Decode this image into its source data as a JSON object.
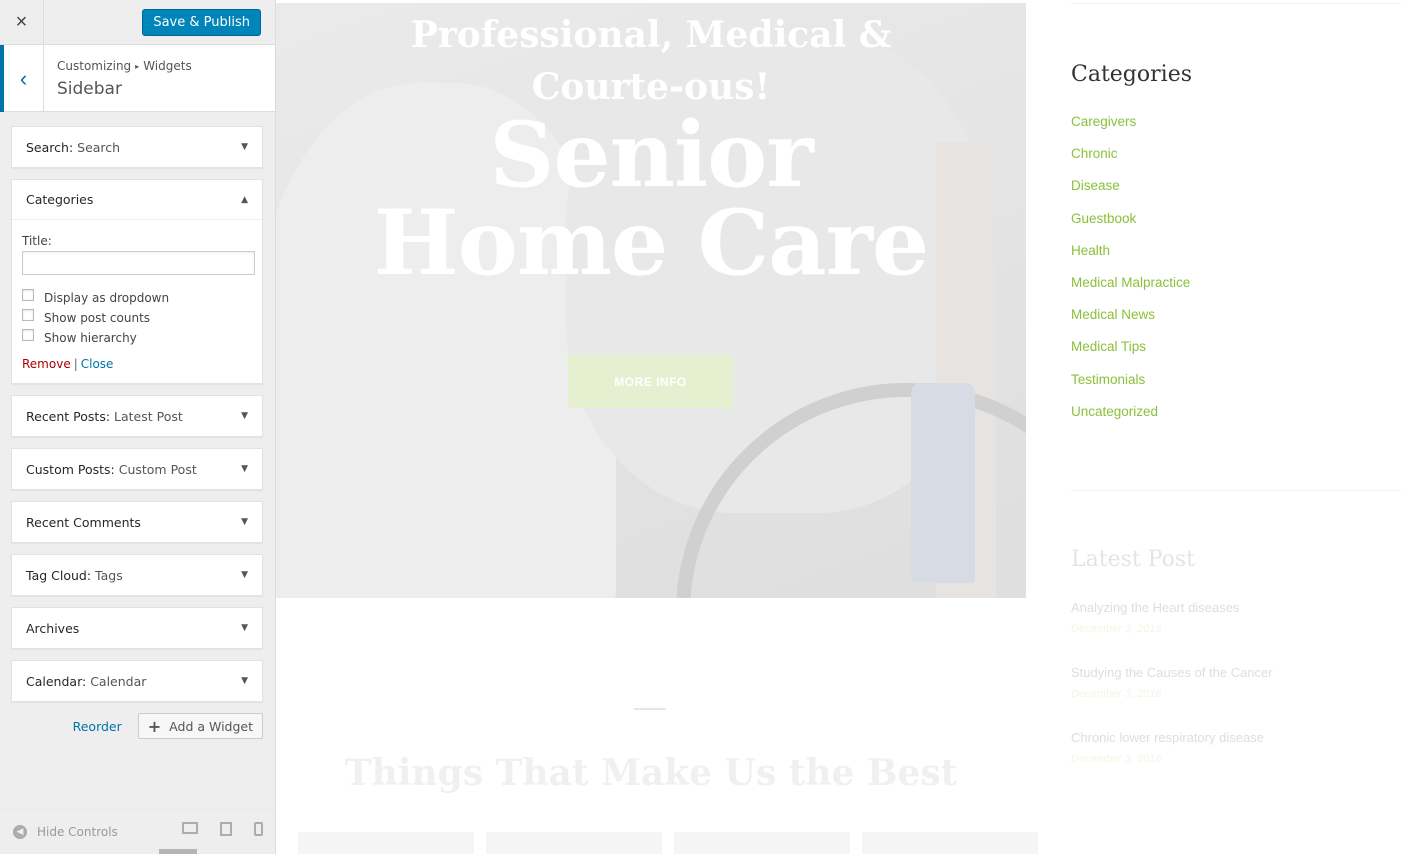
{
  "customizer": {
    "close_label": "×",
    "publish_label": "Save & Publish",
    "back_label": "‹",
    "breadcrumb": {
      "root": "Customizing",
      "separator": "▸",
      "parent": "Widgets"
    },
    "section_title": "Sidebar",
    "widgets": [
      {
        "name": "Search",
        "title": "Search",
        "open": false
      },
      {
        "name": "Categories",
        "title": "",
        "open": true
      },
      {
        "name": "Recent Posts",
        "title": "Latest Post",
        "open": false
      },
      {
        "name": "Custom Posts",
        "title": "Custom Post",
        "open": false
      },
      {
        "name": "Recent Comments",
        "title": "",
        "open": false
      },
      {
        "name": "Tag Cloud",
        "title": "Tags",
        "open": false
      },
      {
        "name": "Archives",
        "title": "",
        "open": false
      },
      {
        "name": "Calendar",
        "title": "Calendar",
        "open": false
      }
    ],
    "categories_form": {
      "title_label": "Title:",
      "title_value": "",
      "checkboxes": [
        {
          "label": "Display as dropdown",
          "checked": false
        },
        {
          "label": "Show post counts",
          "checked": false
        },
        {
          "label": "Show hierarchy",
          "checked": false
        }
      ],
      "remove_label": "Remove",
      "separator": "|",
      "close_label": "Close"
    },
    "reorder_label": "Reorder",
    "add_widget_label": "Add a Widget",
    "hide_controls_label": "Hide Controls"
  },
  "preview": {
    "hero": {
      "subtitle": "Professional, Medical & Courte-ous!",
      "title_line1": "Senior",
      "title_line2": "Home Care",
      "button_label": "MORE INFO"
    },
    "section_title": "Things That Make Us the Best",
    "sidebar": {
      "categories_heading": "Categories",
      "categories": [
        "Caregivers",
        "Chronic",
        "Disease",
        "Guestbook",
        "Health",
        "Medical Malpractice",
        "Medical News",
        "Medical Tips",
        "Testimonials",
        "Uncategorized"
      ],
      "latest_heading": "Latest Post",
      "latest_posts": [
        {
          "title": "Analyzing the Heart diseases",
          "date": "December 3, 2016"
        },
        {
          "title": "Studying the Causes of the Cancer",
          "date": "December 3, 2016"
        },
        {
          "title": "Chronic lower respiratory disease",
          "date": "December 3, 2016"
        }
      ]
    }
  },
  "colors": {
    "accent_blue": "#0085ba",
    "link_green": "#8cbf3a",
    "remove_red": "#aa0000"
  }
}
